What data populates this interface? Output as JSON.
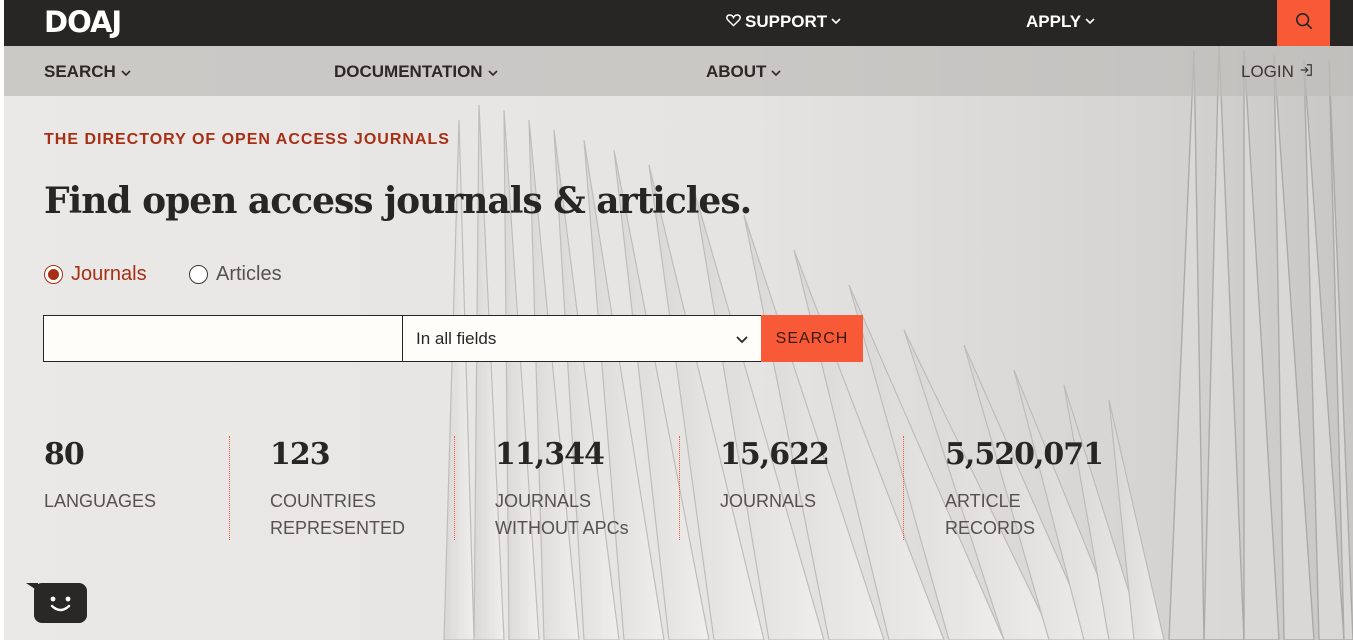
{
  "topbar": {
    "logo": "DOAJ",
    "support": "SUPPORT",
    "apply": "APPLY"
  },
  "subnav": {
    "search": "SEARCH",
    "documentation": "DOCUMENTATION",
    "about": "ABOUT",
    "login": "LOGIN"
  },
  "hero": {
    "eyebrow": "THE DIRECTORY OF OPEN ACCESS JOURNALS",
    "headline": "Find open access journals & articles.",
    "radios": [
      {
        "label": "Journals",
        "checked": true
      },
      {
        "label": "Articles",
        "checked": false
      }
    ],
    "search_value": "",
    "field_selected": "In all fields",
    "search_button": "SEARCH"
  },
  "stats": [
    {
      "number": "80",
      "label_1": "LANGUAGES",
      "label_2": ""
    },
    {
      "number": "123",
      "label_1": "COUNTRIES",
      "label_2": "REPRESENTED"
    },
    {
      "number": "11,344",
      "label_1": "JOURNALS",
      "label_2": "WITHOUT APCs"
    },
    {
      "number": "15,622",
      "label_1": "JOURNALS",
      "label_2": ""
    },
    {
      "number": "5,520,071",
      "label_1": "ARTICLE",
      "label_2": "RECORDS"
    }
  ],
  "colors": {
    "accent": "#f85a38",
    "brand_dark": "#282624",
    "eyebrow": "#a62f14"
  },
  "icons": {
    "heart": "heart-icon",
    "search": "search-icon",
    "login": "login-arrow-icon",
    "chat": "chat-face-icon"
  }
}
